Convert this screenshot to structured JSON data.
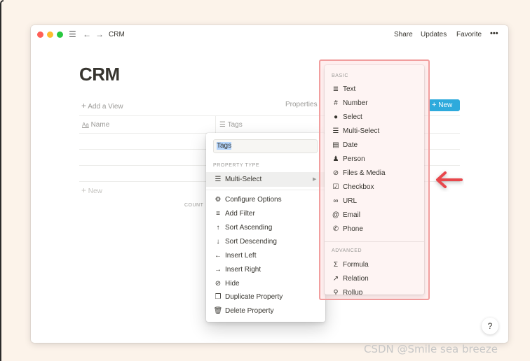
{
  "window": {
    "breadcrumb": "CRM",
    "top_actions": [
      "Share",
      "Updates",
      "Favorite",
      "•••"
    ]
  },
  "page": {
    "title": "CRM",
    "add_view": "Add a View",
    "properties": "Properties",
    "new_button": "New",
    "columns": [
      "Name",
      "Tags"
    ],
    "new_row": "New",
    "count_label": "COUNT"
  },
  "property_menu": {
    "input_value": "Tags",
    "section_label": "PROPERTY TYPE",
    "current_type": "Multi-Select",
    "items": [
      {
        "label": "Configure Options",
        "icon": "gear-icon"
      },
      {
        "label": "Add Filter",
        "icon": "filter-icon"
      },
      {
        "label": "Sort Ascending",
        "icon": "arrow-up-icon"
      },
      {
        "label": "Sort Descending",
        "icon": "arrow-down-icon"
      },
      {
        "label": "Insert Left",
        "icon": "arrow-left-icon"
      },
      {
        "label": "Insert Right",
        "icon": "arrow-right-icon"
      },
      {
        "label": "Hide",
        "icon": "eye-slash-icon"
      },
      {
        "label": "Duplicate Property",
        "icon": "duplicate-icon"
      },
      {
        "label": "Delete Property",
        "icon": "trash-icon"
      }
    ]
  },
  "type_menu": {
    "basic_label": "BASIC",
    "basic_items": [
      {
        "label": "Text",
        "icon": "text-icon"
      },
      {
        "label": "Number",
        "icon": "hash-icon"
      },
      {
        "label": "Select",
        "icon": "select-icon"
      },
      {
        "label": "Multi-Select",
        "icon": "list-icon"
      },
      {
        "label": "Date",
        "icon": "calendar-icon"
      },
      {
        "label": "Person",
        "icon": "person-icon"
      },
      {
        "label": "Files & Media",
        "icon": "paperclip-icon"
      },
      {
        "label": "Checkbox",
        "icon": "checkbox-icon"
      },
      {
        "label": "URL",
        "icon": "link-icon"
      },
      {
        "label": "Email",
        "icon": "at-icon"
      },
      {
        "label": "Phone",
        "icon": "phone-icon"
      }
    ],
    "advanced_label": "ADVANCED",
    "advanced_items": [
      {
        "label": "Formula",
        "icon": "sigma-icon"
      },
      {
        "label": "Relation",
        "icon": "arrow-northeast-icon"
      },
      {
        "label": "Rollup",
        "icon": "search-icon"
      }
    ]
  },
  "help_label": "?",
  "watermark": "CSDN @Smile sea breeze",
  "colors": {
    "accent": "#2eaadc",
    "highlight_frame": "#f19e9e",
    "annotation_arrow": "#e8474c"
  }
}
